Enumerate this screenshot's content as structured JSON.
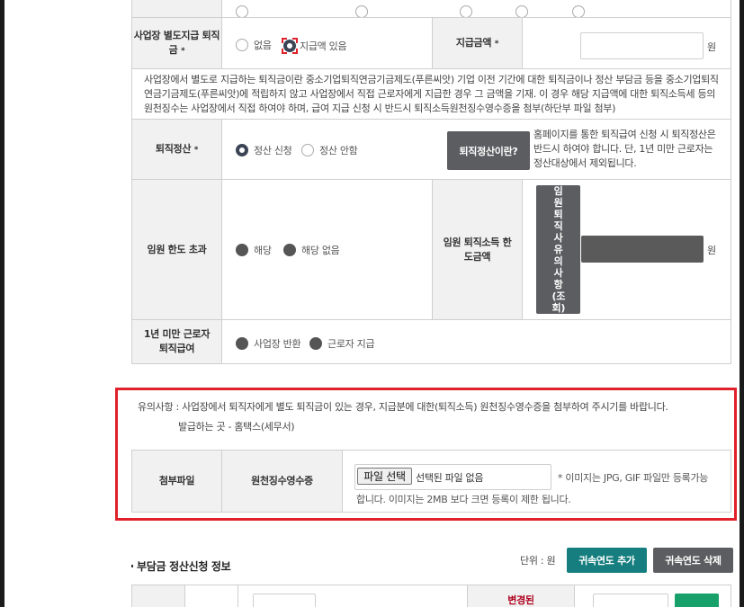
{
  "form": {
    "separate_pay": {
      "label": "사업장 별도지급 퇴직금",
      "required_mark": "*",
      "options": [
        "없음",
        "지급액 있음"
      ],
      "selected": "지급액 있음"
    },
    "pay_amount": {
      "label": "지급금액",
      "required_mark": "*",
      "value": "",
      "unit": "원"
    },
    "notice_text": "사업장에서 별도로 지급하는 퇴직금이란 중소기업퇴직연금기금제도(푸른씨앗) 기업 이전 기간에 대한 퇴직금이나 정산 부담금 등을 중소기업퇴직연금기금제도(푸른씨앗)에 적립하지 않고 사업장에서 직접 근로자에게 지급한 경우 그 금액을 기재. 이 경우 해당 지급액에 대한 퇴직소득세 등의 원천징수는 사업장에서 직접 하여야 하며, 급여 지급 신청 시 반드시 퇴직소득원천징수영수증을 첨부(하단부 파일 첨부)",
    "settlement": {
      "label": "퇴직정산",
      "required_mark": "*",
      "options": [
        "정산 신청",
        "정산 안함"
      ],
      "selected": "정산 신청",
      "help_button": "퇴직정산이란?",
      "help_text": "홈페이지를 통한 퇴직급여 신청 시 퇴직정산은 반드시 하여야 합니다. 단, 1년 미만 근로자는 정산대상에서 제외됩니다."
    },
    "exec_excess": {
      "label": "임원 한도 초과",
      "options": [
        "해당",
        "해당 없음"
      ]
    },
    "exec_limit": {
      "label": "임원 퇴직소득 한도금액",
      "lookup_button": "임원퇴직사유의사항(조회)",
      "value": "",
      "unit": "원"
    },
    "under_one_year": {
      "label": "1년 미만 근로자 퇴직급여",
      "options": [
        "사업장 반환",
        "근로자 지급"
      ]
    }
  },
  "attachment": {
    "caution": "유의사항 : 사업장에서 퇴직자에게 별도 퇴직금이 있는 경우, 지급분에 대한(퇴직소득) 원천징수영수증을 첨부하여 주시기를 바랍니다.",
    "issuer": "발급하는 곳 - 홈택스(세무서)",
    "row_label": "첨부파일",
    "doc_label": "원천징수영수증",
    "file_button": "파일 선택",
    "file_status": "선택된 파일 없음",
    "file_note": "* 이미지는 JPG, GIF 파일만 등록가능합니다. 이미지는 2MB 보다 크면 등록이 제한 됩니다."
  },
  "burden": {
    "title": "부담금 정산신청 정보",
    "unit": "단위 : 원",
    "add_button": "귀속연도 추가",
    "delete_button": "귀속연도 삭제",
    "partial_header": "변경된"
  },
  "colors": {
    "required_red": "#b0001e",
    "highlight_red": "#e0202a",
    "teal": "#167e7f",
    "dark_gray": "#5b5d60"
  }
}
